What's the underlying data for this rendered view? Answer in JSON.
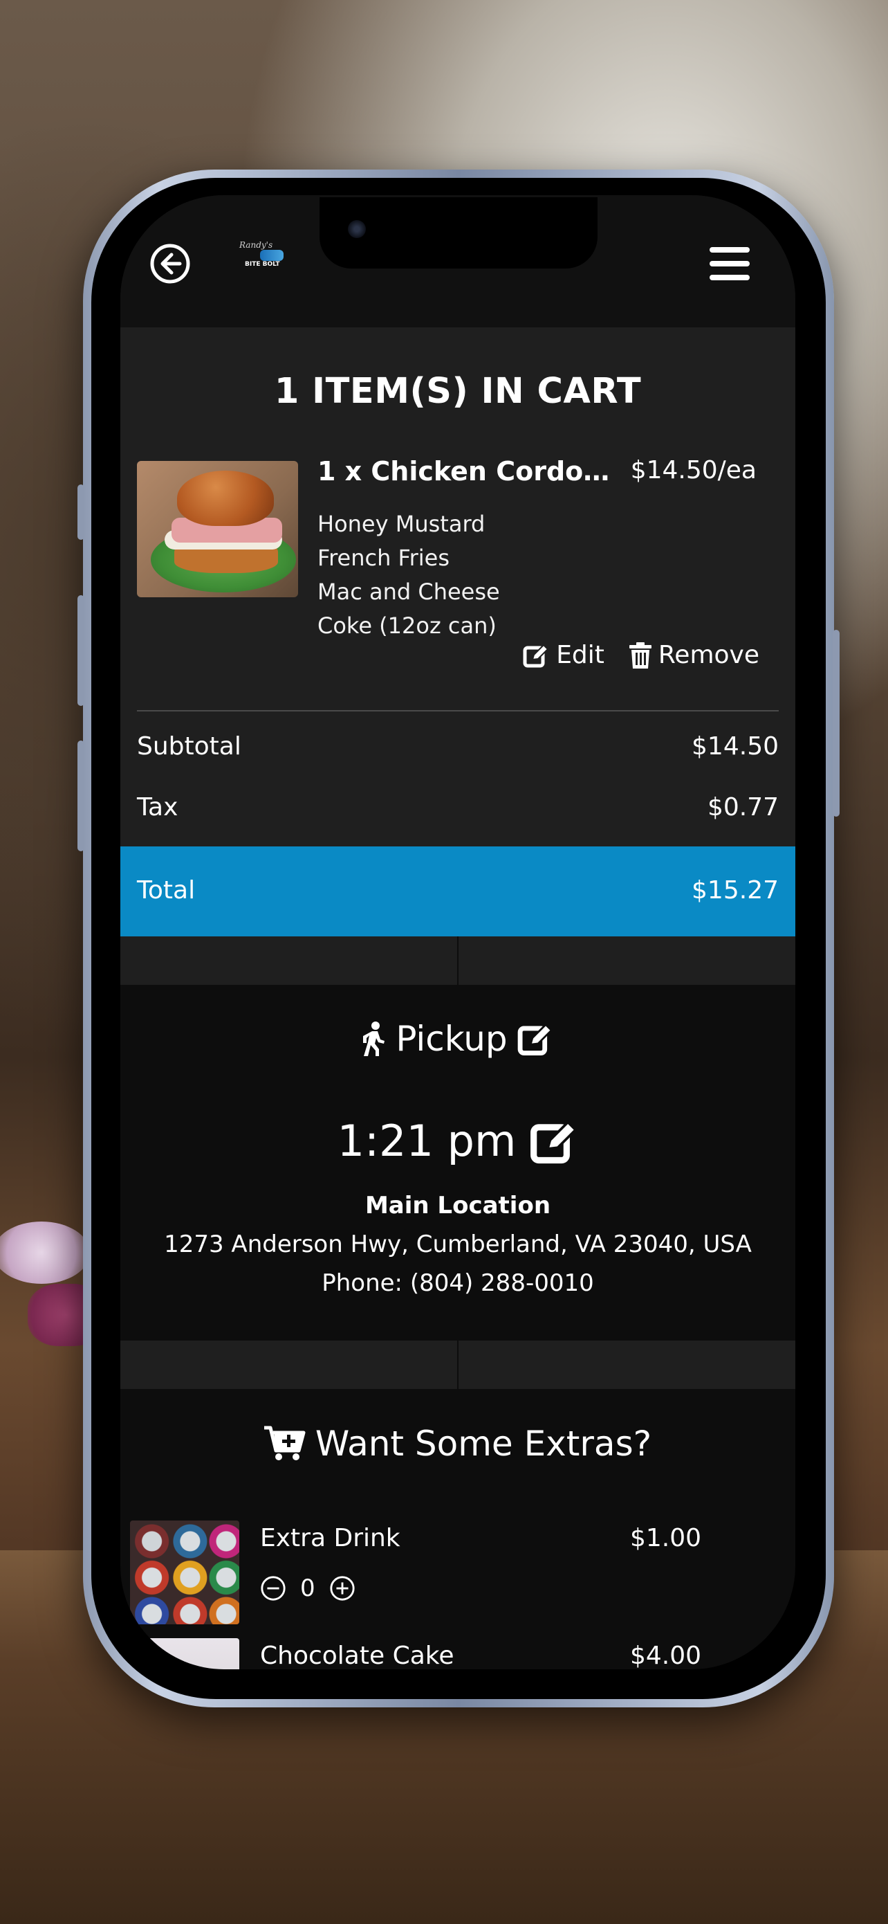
{
  "header": {
    "back_icon": "arrow-left-circle-icon",
    "logo_text_top": "Randy's",
    "logo_text_bottom": "BITE BOLT",
    "menu_icon": "hamburger-menu-icon"
  },
  "cart": {
    "title": "1 ITEM(S) IN CART",
    "item": {
      "name": "1 x Chicken Cordon...",
      "price": "$14.50/ea",
      "modifiers": [
        "Honey Mustard",
        "French Fries",
        "Mac and Cheese",
        "Coke (12oz can)"
      ],
      "edit_label": "Edit",
      "remove_label": "Remove"
    },
    "subtotal_label": "Subtotal",
    "subtotal_value": "$14.50",
    "tax_label": "Tax",
    "tax_value": "$0.77",
    "total_label": "Total",
    "total_value": "$15.27"
  },
  "pickup": {
    "title": "Pickup",
    "time": "1:21 pm",
    "location_name": "Main Location",
    "address": "1273 Anderson Hwy, Cumberland, VA 23040, USA",
    "phone": "Phone: (804) 288-0010"
  },
  "extras": {
    "title": "Want Some Extras?",
    "items": [
      {
        "name": "Extra Drink",
        "price": "$1.00",
        "qty": "0"
      },
      {
        "name": "Chocolate Cake",
        "price": "$4.00"
      }
    ]
  },
  "colors": {
    "accent": "#0a8ac5",
    "panel": "#1f1f1f",
    "background": "#0d0d0d"
  }
}
